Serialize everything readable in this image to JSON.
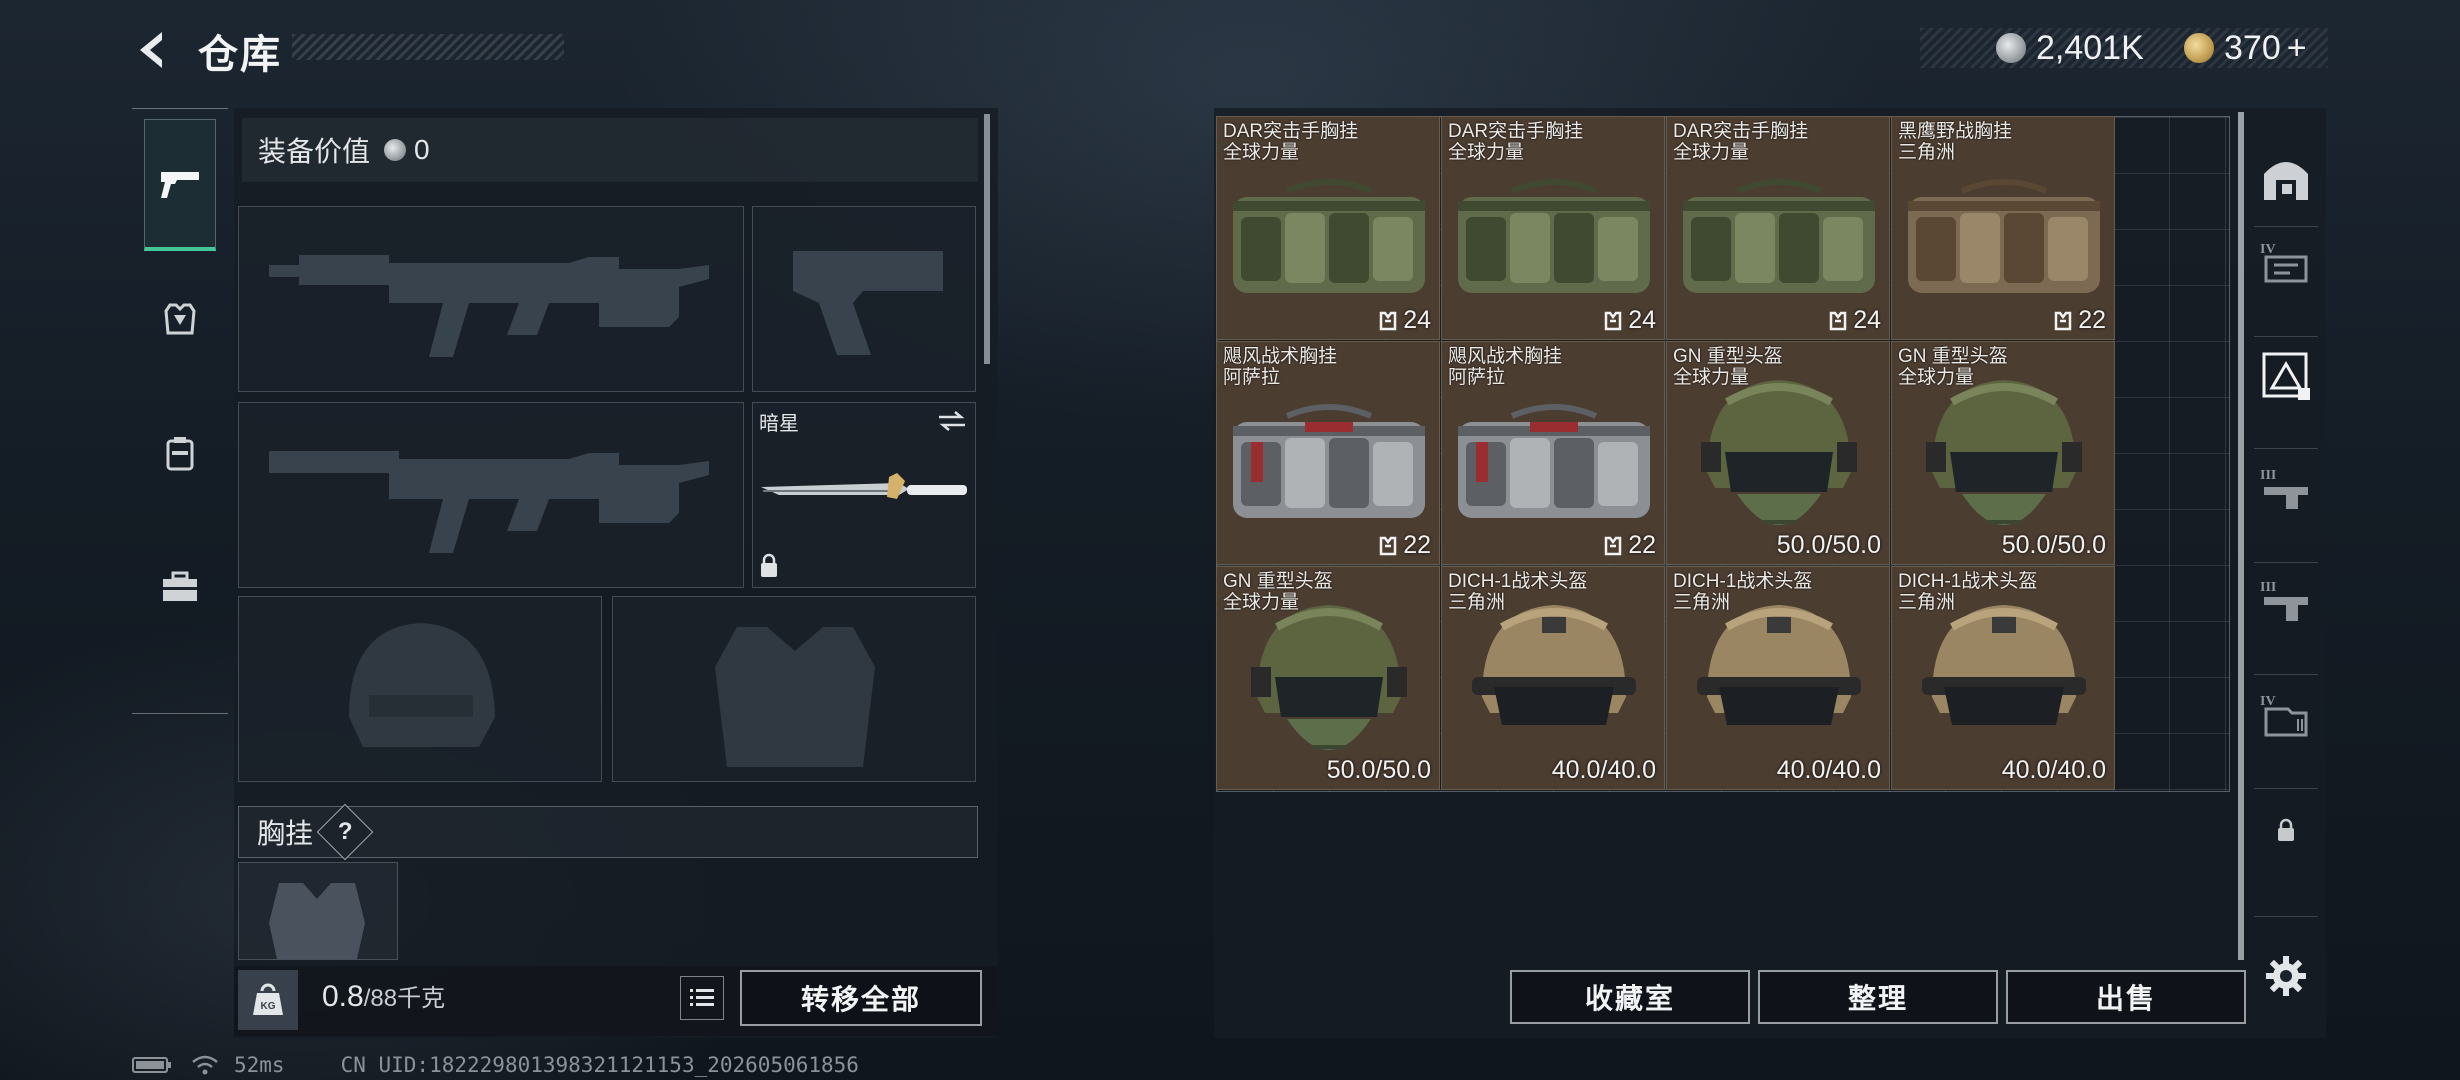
{
  "header": {
    "title": "仓库",
    "currency_silver": "2,401K",
    "currency_gold": "370",
    "currency_gold_add": "+"
  },
  "left_panel": {
    "equip_value_label": "装备价值",
    "equip_value": "0",
    "melee_slot_label": "暗星",
    "chest_rig_label": "胸挂",
    "help_badge": "?",
    "weight_current": "0.8",
    "weight_max": "/88千克",
    "transfer_all_label": "转移全部"
  },
  "items": [
    {
      "name": "DAR突击手胸挂",
      "sub": "全球力量",
      "count": "24",
      "type": "rig",
      "color": "green"
    },
    {
      "name": "DAR突击手胸挂",
      "sub": "全球力量",
      "count": "24",
      "type": "rig",
      "color": "green"
    },
    {
      "name": "DAR突击手胸挂",
      "sub": "全球力量",
      "count": "24",
      "type": "rig",
      "color": "green"
    },
    {
      "name": "黑鹰野战胸挂",
      "sub": "三角洲",
      "count": "22",
      "type": "rig",
      "color": "tan"
    },
    {
      "name": "飓风战术胸挂",
      "sub": "阿萨拉",
      "count": "22",
      "type": "rig",
      "color": "grey"
    },
    {
      "name": "飓风战术胸挂",
      "sub": "阿萨拉",
      "count": "22",
      "type": "rig",
      "color": "grey"
    },
    {
      "name": "GN 重型头盔",
      "sub": "全球力量",
      "durability": "50.0/50.0",
      "type": "helmet",
      "color": "olive"
    },
    {
      "name": "GN 重型头盔",
      "sub": "全球力量",
      "durability": "50.0/50.0",
      "type": "helmet",
      "color": "olive"
    },
    {
      "name": "GN 重型头盔",
      "sub": "全球力量",
      "durability": "50.0/50.0",
      "type": "helmet",
      "color": "olive"
    },
    {
      "name": "DICH-1战术头盔",
      "sub": "三角洲",
      "durability": "40.0/40.0",
      "type": "helmet2",
      "color": "khaki"
    },
    {
      "name": "DICH-1战术头盔",
      "sub": "三角洲",
      "durability": "40.0/40.0",
      "type": "helmet2",
      "color": "khaki"
    },
    {
      "name": "DICH-1战术头盔",
      "sub": "三角洲",
      "durability": "40.0/40.0",
      "type": "helmet2",
      "color": "khaki"
    }
  ],
  "right_panel": {
    "btn_collection": "收藏室",
    "btn_sort": "整理",
    "btn_sell": "出售"
  },
  "status": {
    "ping": "52ms",
    "uid": "CN UID:18222980139832112115​3_202605061856"
  },
  "colors": {
    "accent_green": "#46c79a",
    "cell_bg": "#4c3d31"
  }
}
